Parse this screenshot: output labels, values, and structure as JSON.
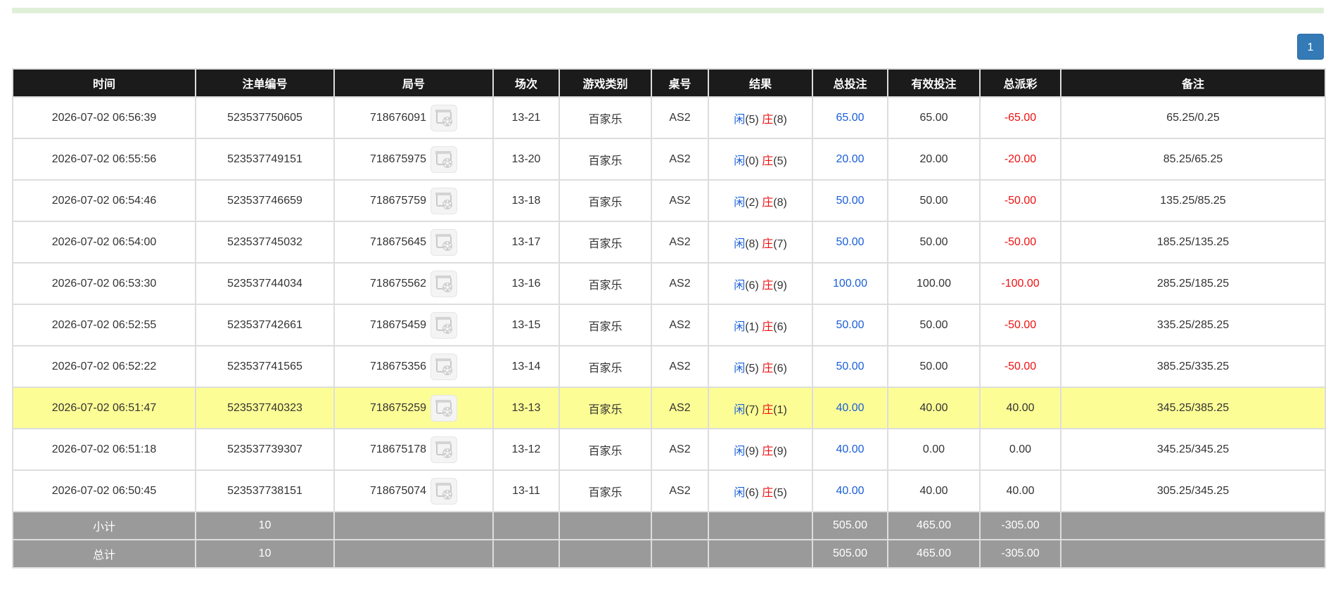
{
  "pager": {
    "current": "1"
  },
  "table": {
    "headers": [
      "时间",
      "注单编号",
      "局号",
      "场次",
      "游戏类别",
      "桌号",
      "结果",
      "总投注",
      "有效投注",
      "总派彩",
      "备注"
    ],
    "result_player_label": "闲",
    "result_banker_label": "庄",
    "rows": [
      {
        "time": "2026-07-02 06:56:39",
        "bet_id": "523537750605",
        "round_id": "718676091",
        "shoe": "13-21",
        "game": "百家乐",
        "table": "AS2",
        "player": "(5)",
        "banker": "(8)",
        "total_bet": "65.00",
        "valid_bet": "65.00",
        "payout": "-65.00",
        "payout_negative": true,
        "note": "65.25/0.25",
        "highlight": false
      },
      {
        "time": "2026-07-02 06:55:56",
        "bet_id": "523537749151",
        "round_id": "718675975",
        "shoe": "13-20",
        "game": "百家乐",
        "table": "AS2",
        "player": "(0)",
        "banker": "(5)",
        "total_bet": "20.00",
        "valid_bet": "20.00",
        "payout": "-20.00",
        "payout_negative": true,
        "note": "85.25/65.25",
        "highlight": false
      },
      {
        "time": "2026-07-02 06:54:46",
        "bet_id": "523537746659",
        "round_id": "718675759",
        "shoe": "13-18",
        "game": "百家乐",
        "table": "AS2",
        "player": "(2)",
        "banker": "(8)",
        "total_bet": "50.00",
        "valid_bet": "50.00",
        "payout": "-50.00",
        "payout_negative": true,
        "note": "135.25/85.25",
        "highlight": false
      },
      {
        "time": "2026-07-02 06:54:00",
        "bet_id": "523537745032",
        "round_id": "718675645",
        "shoe": "13-17",
        "game": "百家乐",
        "table": "AS2",
        "player": "(8)",
        "banker": "(7)",
        "total_bet": "50.00",
        "valid_bet": "50.00",
        "payout": "-50.00",
        "payout_negative": true,
        "note": "185.25/135.25",
        "highlight": false
      },
      {
        "time": "2026-07-02 06:53:30",
        "bet_id": "523537744034",
        "round_id": "718675562",
        "shoe": "13-16",
        "game": "百家乐",
        "table": "AS2",
        "player": "(6)",
        "banker": "(9)",
        "total_bet": "100.00",
        "valid_bet": "100.00",
        "payout": "-100.00",
        "payout_negative": true,
        "note": "285.25/185.25",
        "highlight": false
      },
      {
        "time": "2026-07-02 06:52:55",
        "bet_id": "523537742661",
        "round_id": "718675459",
        "shoe": "13-15",
        "game": "百家乐",
        "table": "AS2",
        "player": "(1)",
        "banker": "(6)",
        "total_bet": "50.00",
        "valid_bet": "50.00",
        "payout": "-50.00",
        "payout_negative": true,
        "note": "335.25/285.25",
        "highlight": false
      },
      {
        "time": "2026-07-02 06:52:22",
        "bet_id": "523537741565",
        "round_id": "718675356",
        "shoe": "13-14",
        "game": "百家乐",
        "table": "AS2",
        "player": "(5)",
        "banker": "(6)",
        "total_bet": "50.00",
        "valid_bet": "50.00",
        "payout": "-50.00",
        "payout_negative": true,
        "note": "385.25/335.25",
        "highlight": false
      },
      {
        "time": "2026-07-02 06:51:47",
        "bet_id": "523537740323",
        "round_id": "718675259",
        "shoe": "13-13",
        "game": "百家乐",
        "table": "AS2",
        "player": "(7)",
        "banker": "(1)",
        "total_bet": "40.00",
        "valid_bet": "40.00",
        "payout": "40.00",
        "payout_negative": false,
        "note": "345.25/385.25",
        "highlight": true
      },
      {
        "time": "2026-07-02 06:51:18",
        "bet_id": "523537739307",
        "round_id": "718675178",
        "shoe": "13-12",
        "game": "百家乐",
        "table": "AS2",
        "player": "(9)",
        "banker": "(9)",
        "total_bet": "40.00",
        "valid_bet": "0.00",
        "payout": "0.00",
        "payout_negative": false,
        "note": "345.25/345.25",
        "highlight": false
      },
      {
        "time": "2026-07-02 06:50:45",
        "bet_id": "523537738151",
        "round_id": "718675074",
        "shoe": "13-11",
        "game": "百家乐",
        "table": "AS2",
        "player": "(6)",
        "banker": "(5)",
        "total_bet": "40.00",
        "valid_bet": "40.00",
        "payout": "40.00",
        "payout_negative": false,
        "note": "305.25/345.25",
        "highlight": false
      }
    ],
    "footer": [
      {
        "label": "小计",
        "count": "10",
        "total_bet": "505.00",
        "valid_bet": "465.00",
        "payout": "-305.00"
      },
      {
        "label": "总计",
        "count": "10",
        "total_bet": "505.00",
        "valid_bet": "465.00",
        "payout": "-305.00"
      }
    ]
  },
  "icons": {
    "replay": "video-replay-icon"
  },
  "colors": {
    "header_bg": "#1b1b1b",
    "footer_bg": "#9a9a9a",
    "highlight_row": "#fdfd96",
    "player_blue": "#1a5fd8",
    "banker_red": "#ee1111",
    "pager_blue": "#337ab7"
  }
}
